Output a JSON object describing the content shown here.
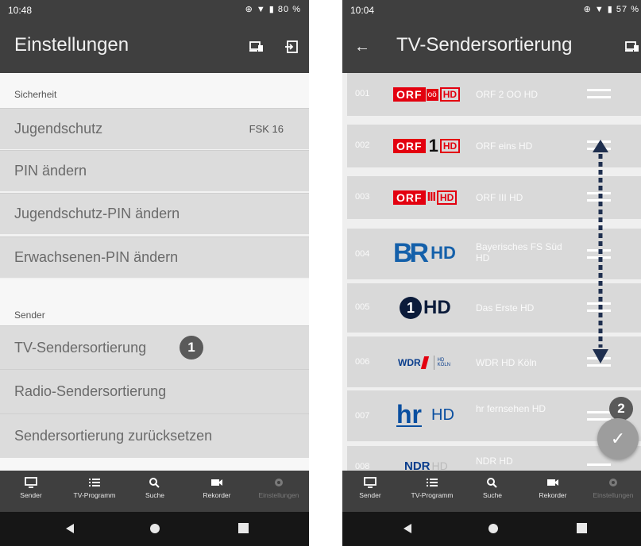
{
  "left": {
    "status": {
      "time": "10:48",
      "icons": "⊕ ▼ ▮ 80 %"
    },
    "title": "Einstellungen",
    "sections": [
      {
        "label": "Sicherheit"
      },
      {
        "label": "Sender"
      }
    ],
    "rows": {
      "jugendschutz": {
        "label": "Jugendschutz",
        "value": "FSK 16"
      },
      "pin": {
        "label": "PIN ändern"
      },
      "jugendpin": {
        "label": "Jugendschutz-PIN ändern"
      },
      "erwpin": {
        "label": "Erwachsenen-PIN ändern"
      },
      "tvsort": {
        "label": "TV-Sendersortierung",
        "marker": "1"
      },
      "radiosort": {
        "label": "Radio-Sendersortierung"
      },
      "reset": {
        "label": "Sendersortierung zurücksetzen"
      }
    }
  },
  "right": {
    "status": {
      "time": "10:04",
      "icons": "⊕ ▼ ▮ 57 %"
    },
    "title": "TV-Sendersortierung",
    "channels": [
      {
        "num": "001",
        "logo": "ORF oö HD",
        "name": "ORF 2 OO HD"
      },
      {
        "num": "002",
        "logo": "ORF 1 HD",
        "name": "ORF eins HD"
      },
      {
        "num": "003",
        "logo": "ORF III HD",
        "name": "ORF III HD"
      },
      {
        "num": "004",
        "logo": "BR HD",
        "name": "Bayerisches FS Süd HD"
      },
      {
        "num": "005",
        "logo": "1 HD",
        "name": "Das Erste HD"
      },
      {
        "num": "006",
        "logo": "WDR HD KÖLN",
        "name": "WDR HD Köln"
      },
      {
        "num": "007",
        "logo": "hr HD",
        "name": "hr fernsehen HD"
      },
      {
        "num": "008",
        "logo": "NDR HD",
        "name": "NDR HD"
      }
    ],
    "marker": "2",
    "fab_icon": "✓"
  },
  "nav": [
    {
      "label": "Sender",
      "icon": "tv-icon"
    },
    {
      "label": "TV-Programm",
      "icon": "list-icon"
    },
    {
      "label": "Suche",
      "icon": "search-icon"
    },
    {
      "label": "Rekorder",
      "icon": "camera-icon"
    },
    {
      "label": "Einstellungen",
      "icon": "gear-icon"
    }
  ],
  "colors": {
    "bar": "#3f3f3f",
    "row": "#dcdcdc",
    "orf_red": "#e3000f",
    "br_blue": "#1460aa",
    "hr_blue": "#0a4fa0"
  }
}
